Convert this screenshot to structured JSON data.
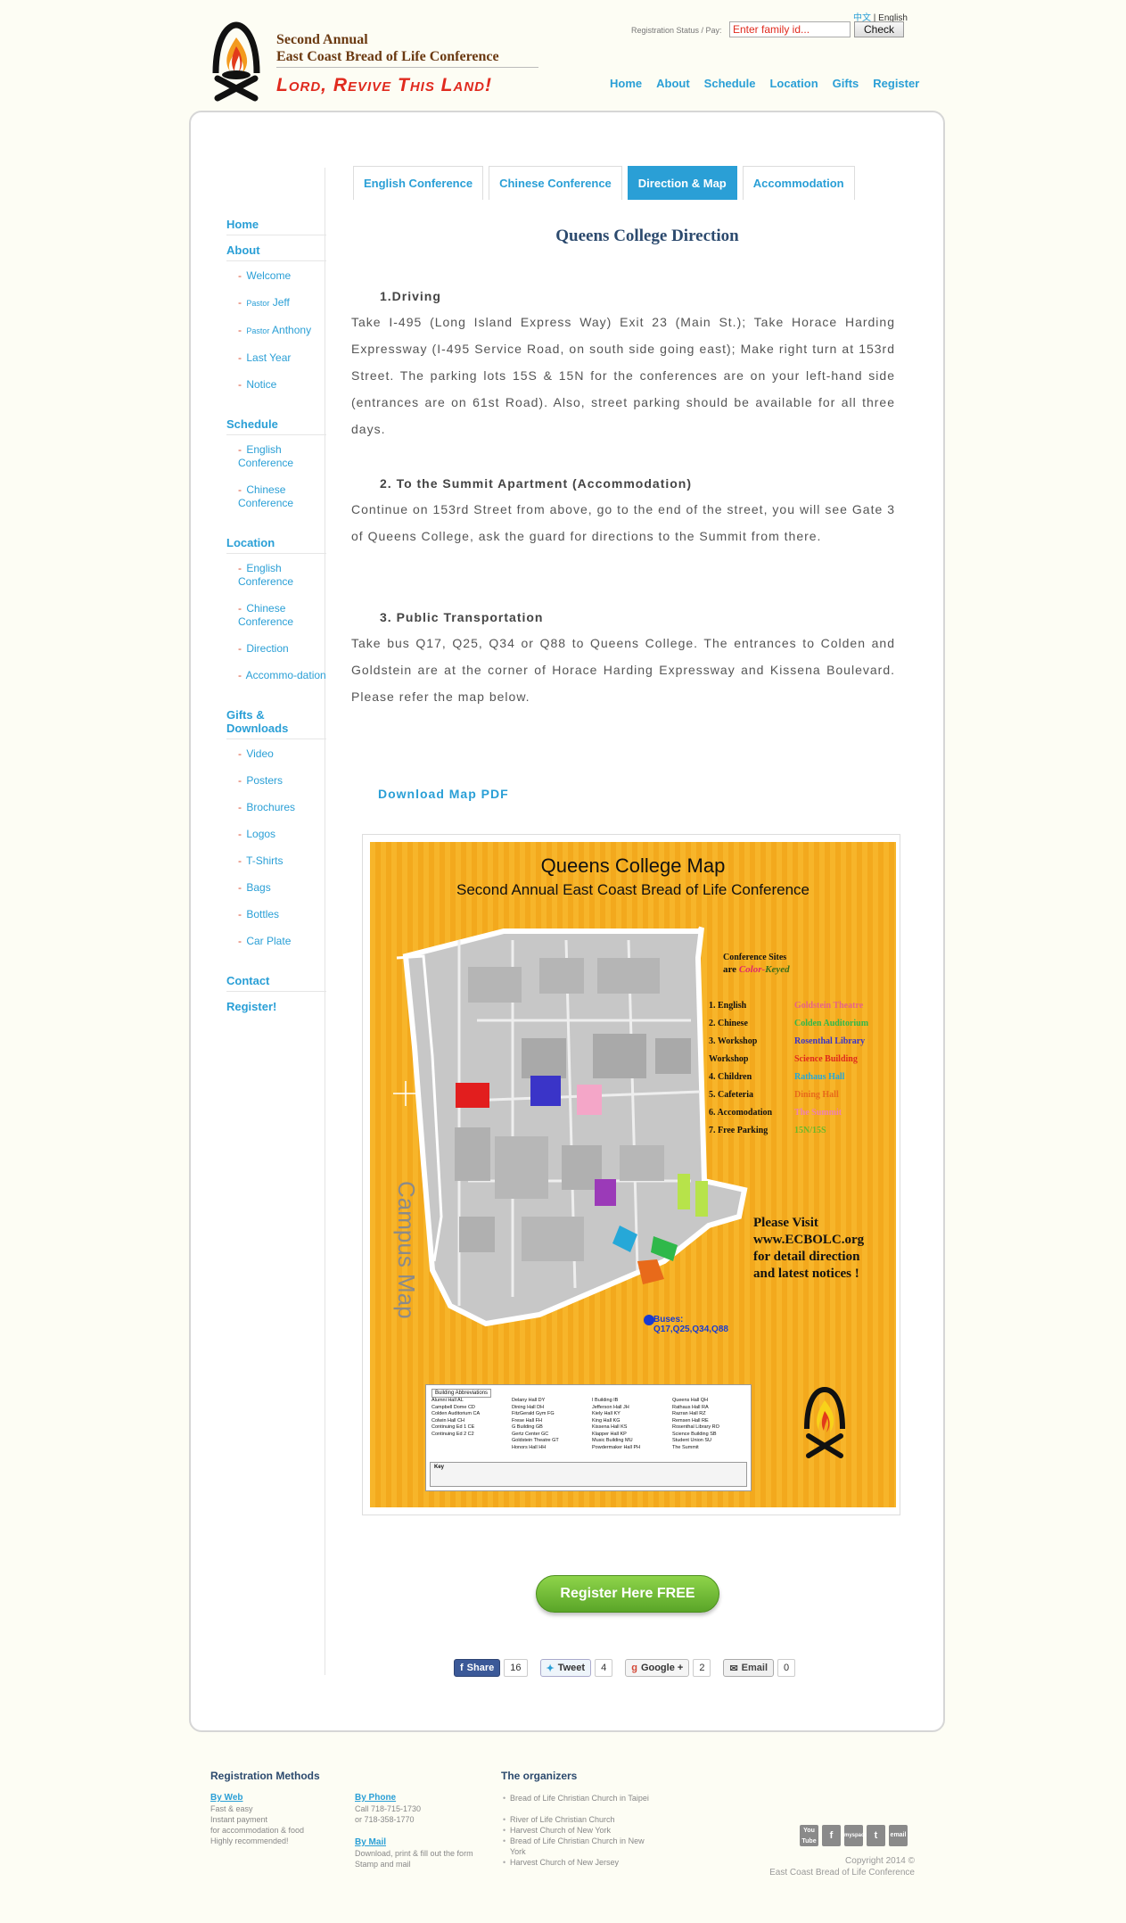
{
  "header": {
    "conf_title_1": "Second Annual",
    "conf_title_2": "East Coast Bread of Life Conference",
    "slogan": "Lord, Revive This Land!",
    "lang_zh": "中文",
    "lang_sep": " | ",
    "lang_en": "English",
    "reg_status_label": "Registration Status / Pay:",
    "family_id_placeholder": "Enter family id...",
    "check_label": "Check",
    "nav": [
      "Home",
      "About",
      "Schedule",
      "Location",
      "Gifts",
      "Register"
    ]
  },
  "sidebar": {
    "home": "Home",
    "about": "About",
    "about_items": [
      {
        "label": "Welcome"
      },
      {
        "prefix": "Pastor",
        "label": "Jeff"
      },
      {
        "prefix": "Pastor",
        "label": "Anthony"
      },
      {
        "label": "Last Year"
      },
      {
        "label": "Notice"
      }
    ],
    "schedule": "Schedule",
    "schedule_items": [
      "English Conference",
      "Chinese Conference"
    ],
    "location": "Location",
    "location_items": [
      "English Conference",
      "Chinese Conference",
      "Direction",
      "Accommo-dation"
    ],
    "gifts": "Gifts & Downloads",
    "gifts_items": [
      "Video",
      "Posters",
      "Brochures",
      "Logos",
      "T-Shirts",
      "Bags",
      "Bottles",
      "Car Plate"
    ],
    "contact": "Contact",
    "register": "Register!"
  },
  "tabs": [
    "English Conference",
    "Chinese Conference",
    "Direction & Map",
    "Accommodation"
  ],
  "active_tab": "Direction & Map",
  "content": {
    "title": "Queens College Direction",
    "sections": [
      {
        "heading": "1.Driving",
        "body": "Take I-495 (Long Island Express Way) Exit 23 (Main St.); Take Horace Harding Expressway (I-495 Service Road, on south side going east); Make right turn at 153rd Street. The parking lots 15S & 15N for the conferences are on your left-hand side (entrances are on 61st Road). Also, street parking should be available for all three days."
      },
      {
        "heading": "2. To the Summit Apartment (Accommodation)",
        "body": "Continue on 153rd Street from above, go to the end of the street, you will see Gate 3 of Queens College, ask the guard for directions to the Summit from there."
      },
      {
        "heading": "3. Public Transportation",
        "body": "Take bus Q17, Q25, Q34 or Q88 to Queens College. The entrances to Colden and Goldstein are at the corner of Horace Harding Expressway and Kissena Boulevard. Please refer the map below."
      }
    ],
    "download_map": "Download Map PDF"
  },
  "map": {
    "title": "Queens College Map",
    "subtitle": "Second Annual East Coast Bread of Life Conference",
    "legend_line_1": "Conference Sites",
    "legend_line_2_prefix": "are ",
    "legend_line_2_color": "Color-",
    "legend_line_2_keyed": "Keyed",
    "sites": [
      {
        "label": "1. English",
        "value": "Goldstein Theatre",
        "color": "#e8608a"
      },
      {
        "label": "2. Chinese",
        "value": "Colden Auditorium",
        "color": "#2fb84a"
      },
      {
        "label": "3. Workshop",
        "value": "Rosenthal Library",
        "color": "#3a34c8"
      },
      {
        "label": "    Workshop",
        "value": "Science Building",
        "color": "#e02a1e"
      },
      {
        "label": "4. Children",
        "value": "Rathaus Hall",
        "color": "#26a8d8"
      },
      {
        "label": "5. Cafeteria",
        "value": "Dining Hall",
        "color": "#e86a1a"
      },
      {
        "label": "6. Accomodation",
        "value": "The Summit",
        "color": "#f080b0"
      },
      {
        "label": "7. Free Parking",
        "value": "15N/15S",
        "color": "#6ab82a"
      }
    ],
    "visit_lines": [
      "Please Visit",
      "www.ECBOLC.org",
      "for detail direction",
      "and latest notices !"
    ],
    "campus_map_label": "Campus Map",
    "buses_label_1": "Buses:",
    "buses_label_2": "Q17,Q25,Q34,Q88",
    "abbrev_title": "Building Abbreviations",
    "abbrev_cols": [
      [
        "Alumni Hall  AL",
        "Campbell Dome  CD",
        "Colden Auditorium  CA",
        "Colwin Hall  CH",
        "Continuing Ed 1  CE",
        "Continuing Ed 2  C2"
      ],
      [
        "Delany Hall  DY",
        "Dining Hall  DH",
        "FitzGerald Gym  FG",
        "Frese Hall  FH",
        "G Building  GB",
        "Gertz Center  GC",
        "Goldstein Theatre  GT",
        "Honors Hall  HH"
      ],
      [
        "I Building  IB",
        "Jefferson Hall  JH",
        "Kiely Hall  KY",
        "King Hall  KG",
        "Kissena Hall  KS",
        "Klapper Hall  KP",
        "Music Building  MU",
        "Powdermaker Hall  PH"
      ],
      [
        "Queens Hall  QH",
        "Rathaus Hall  RA",
        "Razran Hall  RZ",
        "Remsen Hall  RE",
        "Rosenthal Library  RO",
        "Science Building  SB",
        "Student Union  SU",
        "The Summit"
      ]
    ],
    "key_label": "Key"
  },
  "register_button": "Register Here FREE",
  "share": [
    {
      "label": "Share",
      "count": "16"
    },
    {
      "label": "Tweet",
      "count": "4"
    },
    {
      "label": "Google +",
      "count": "2"
    },
    {
      "label": "Email",
      "count": "0"
    }
  ],
  "footer": {
    "reg_methods_title": "Registration Methods",
    "by_web": "By Web",
    "by_web_text": [
      "Fast & easy",
      "Instant payment",
      "for accommodation & food",
      "Highly recommended!"
    ],
    "by_phone": "By Phone",
    "by_phone_text": [
      "Call 718-715-1730",
      "or 718-358-1770"
    ],
    "by_mail": "By Mail",
    "by_mail_text": [
      "Download, print & fill out the form",
      "Stamp and mail"
    ],
    "organizers_title": "The organizers",
    "organizers": [
      "Bread of Life Christian Church in Taipei",
      "River of Life Christian Church",
      "Harvest Church of New York",
      "Bread of Life Christian Church in New York",
      "Harvest Church of New Jersey"
    ],
    "social": [
      "You Tube",
      "f",
      "myspace",
      "t",
      "email"
    ],
    "copyright_1": "Copyright 2014 ©",
    "copyright_2": "East Coast Bread of Life Conference"
  }
}
